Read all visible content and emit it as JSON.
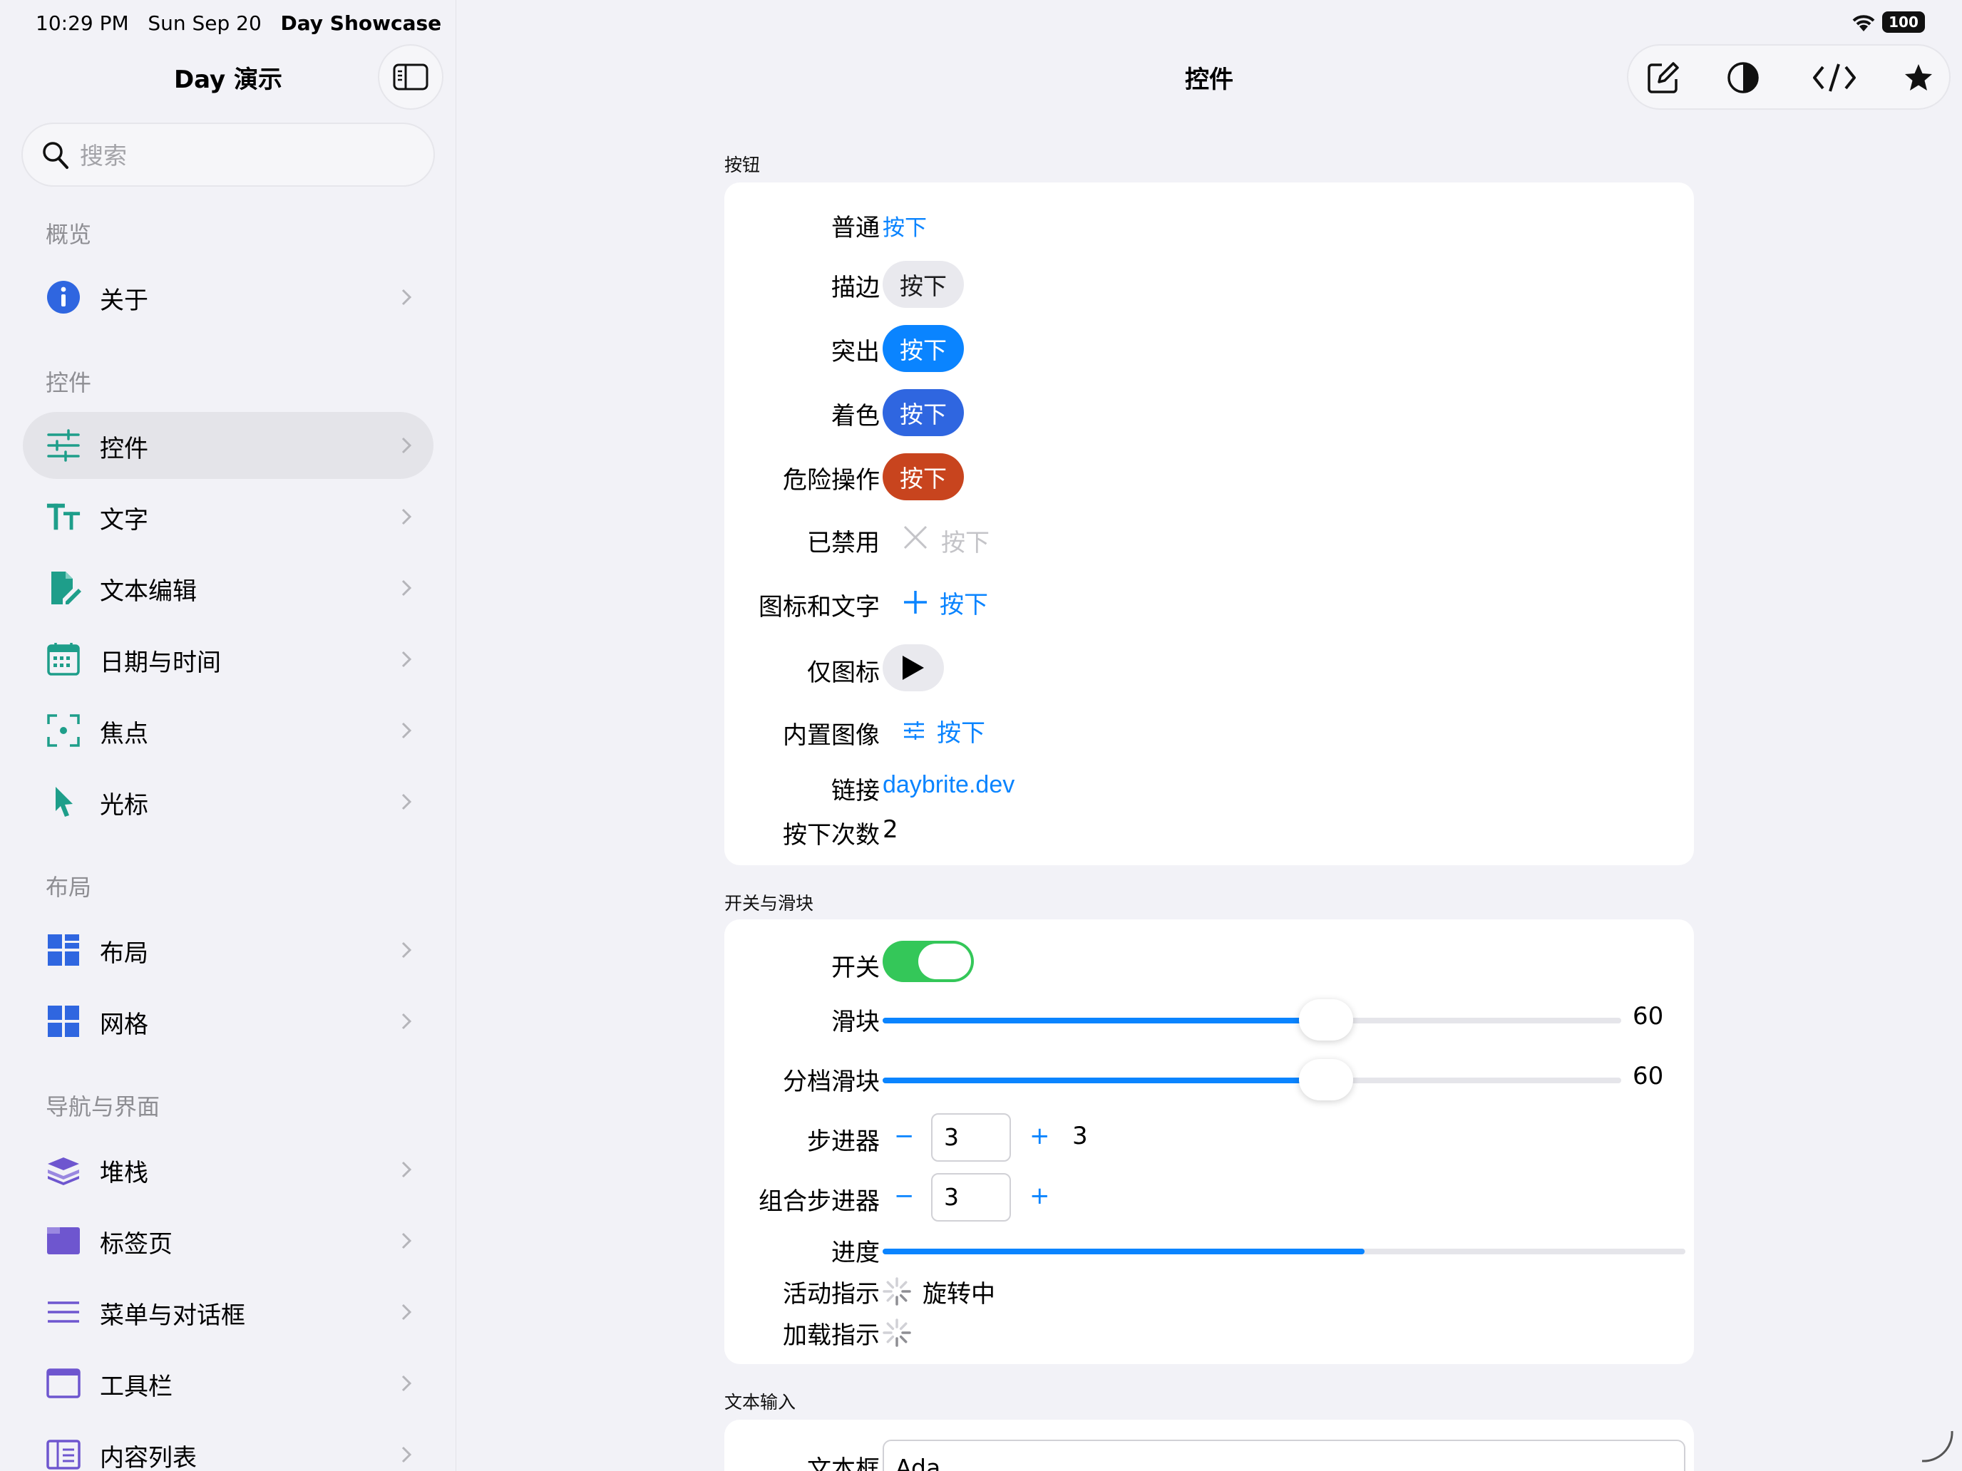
{
  "status_bar": {
    "time": "10:29 PM",
    "date": "Sun Sep 20",
    "app": "Day Showcase",
    "battery": "100"
  },
  "sidebar": {
    "title": "Day 演示",
    "search_placeholder": "搜索",
    "sections": [
      {
        "label": "概览",
        "items": [
          {
            "label": "关于",
            "icon": "info-icon",
            "color": "#2f66e0"
          }
        ]
      },
      {
        "label": "控件",
        "items": [
          {
            "label": "控件",
            "icon": "sliders-icon",
            "color": "#1e9e8a",
            "active": true
          },
          {
            "label": "文字",
            "icon": "text-size-icon",
            "color": "#1e9e8a"
          },
          {
            "label": "文本编辑",
            "icon": "document-edit-icon",
            "color": "#1e9e8a"
          },
          {
            "label": "日期与时间",
            "icon": "calendar-icon",
            "color": "#1e9e8a"
          },
          {
            "label": "焦点",
            "icon": "focus-icon",
            "color": "#1e9e8a"
          },
          {
            "label": "光标",
            "icon": "cursor-icon",
            "color": "#1e9e8a"
          }
        ]
      },
      {
        "label": "布局",
        "items": [
          {
            "label": "布局",
            "icon": "layout-icon",
            "color": "#2f66e0"
          },
          {
            "label": "网格",
            "icon": "grid-icon",
            "color": "#2f66e0"
          }
        ]
      },
      {
        "label": "导航与界面",
        "items": [
          {
            "label": "堆栈",
            "icon": "stack-icon",
            "color": "#6e56cf"
          },
          {
            "label": "标签页",
            "icon": "tabs-icon",
            "color": "#6e56cf"
          },
          {
            "label": "菜单与对话框",
            "icon": "menu-icon",
            "color": "#6e56cf"
          },
          {
            "label": "工具栏",
            "icon": "toolbar-icon",
            "color": "#6e56cf"
          },
          {
            "label": "内容列表",
            "icon": "content-list-icon",
            "color": "#6e56cf"
          }
        ]
      }
    ]
  },
  "main": {
    "title": "控件",
    "toolbar": {
      "edit_icon": "compose-icon",
      "appearance_icon": "contrast-icon",
      "code_icon": "code-icon",
      "favorite_icon": "star-icon"
    },
    "buttons": {
      "title": "按钮",
      "plain_label": "普通",
      "plain_button": "按下",
      "bordered_label": "描边",
      "bordered_button": "按下",
      "prominent_label": "突出",
      "prominent_button": "按下",
      "tinted_label": "着色",
      "tinted_button": "按下",
      "destructive_label": "危险操作",
      "destructive_button": "按下",
      "disabled_label": "已禁用",
      "disabled_button": "按下",
      "icon_text_label": "图标和文字",
      "icon_text_button": "按下",
      "icon_only_label": "仅图标",
      "builtin_label": "内置图像",
      "builtin_button": "按下",
      "link_label": "链接",
      "link_text": "daybrite.dev",
      "count_label": "按下次数",
      "count_value": "2"
    },
    "switches": {
      "title": "开关与滑块",
      "toggle_label": "开关",
      "toggle_on": true,
      "slider_label": "滑块",
      "slider_value": "60",
      "slider_fraction": 0.6,
      "stepped_label": "分档滑块",
      "stepped_value": "60",
      "stepped_fraction": 0.6,
      "stepper_label": "步进器",
      "stepper_minus": "−",
      "stepper_field": "3",
      "stepper_plus": "+",
      "stepper_value": "3",
      "combo_label": "组合步进器",
      "combo_minus": "−",
      "combo_field": "3",
      "combo_plus": "+",
      "progress_label": "进度",
      "progress_fraction": 0.6,
      "activity_label": "活动指示",
      "activity_text": "旋转中",
      "loading_label": "加载指示"
    },
    "text_input": {
      "title": "文本输入",
      "field_label": "文本框",
      "field_value": "Ada"
    }
  },
  "colors": {
    "accent": "#0a84ff",
    "tint": "#2f66e0",
    "destructive": "#c8441e",
    "toggle_on": "#34c759"
  }
}
